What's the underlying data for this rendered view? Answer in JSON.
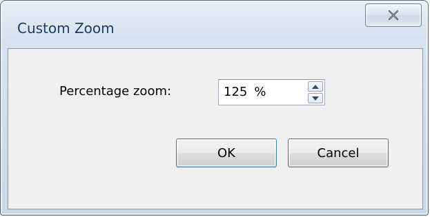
{
  "window": {
    "title": "Custom Zoom",
    "close_icon": "close-icon"
  },
  "form": {
    "zoom_label": "Percentage zoom:",
    "zoom_value": "125",
    "zoom_unit": "%",
    "spin_up_icon": "arrow-up-icon",
    "spin_down_icon": "arrow-down-icon"
  },
  "buttons": {
    "ok_label": "OK",
    "cancel_label": "Cancel"
  },
  "colors": {
    "title_text": "#1e395b",
    "frame": "#c9d8e8",
    "client_bg": "#f0f0f0",
    "default_button_border": "#3c7fb1"
  }
}
